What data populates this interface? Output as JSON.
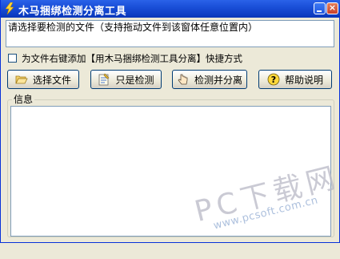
{
  "window": {
    "title": "木马捆绑检测分离工具",
    "minimize_label": "",
    "close_label": "×"
  },
  "path_input": {
    "value": "请选择要检测的文件（支持拖动文件到该窗体任意位置内）"
  },
  "context_menu_option": {
    "label": "为文件右键添加【用木马捆绑检测工具分离】快捷方式",
    "checked": false
  },
  "buttons": {
    "choose_file": {
      "label": "选择文件",
      "icon": "folder-open-icon"
    },
    "check_only": {
      "label": "只是检测",
      "icon": "check-document-icon"
    },
    "check_and_split": {
      "label": "检测并分离",
      "icon": "hand-pointer-icon"
    },
    "help": {
      "label": "帮助说明",
      "icon": "help-icon"
    }
  },
  "info_panel": {
    "legend": "信息",
    "content": ""
  },
  "watermark": {
    "main": "PC下载网",
    "url": "www.pcsoft.com.cn"
  }
}
